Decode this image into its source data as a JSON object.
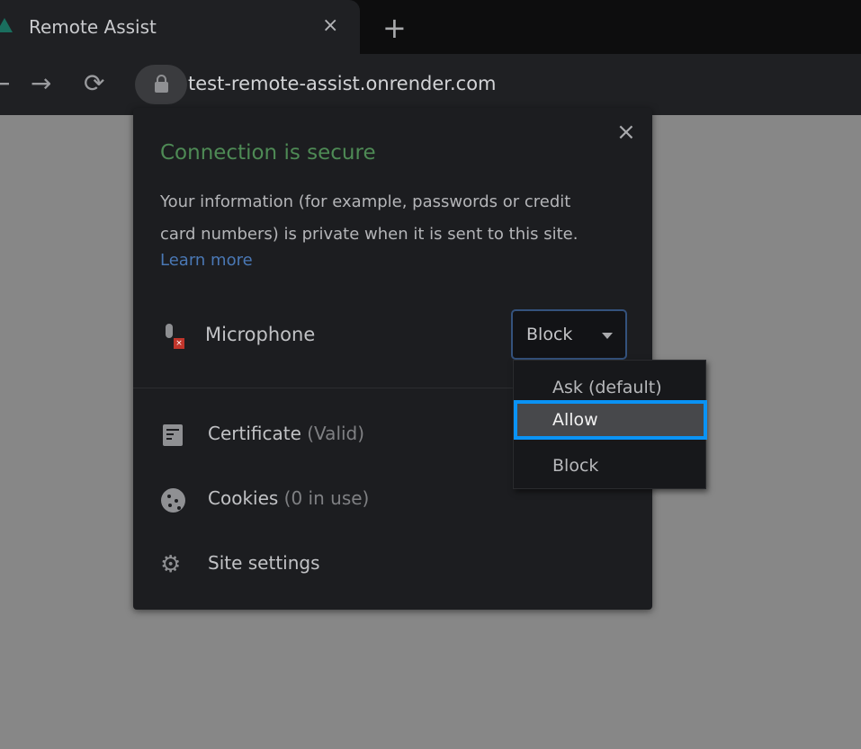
{
  "browser": {
    "tab": {
      "title": "Remote Assist",
      "favicon": "app-triangle-icon",
      "close": "×"
    },
    "new_tab": "+",
    "nav": {
      "back": "←",
      "forward": "→",
      "reload": "⟳"
    },
    "url": "test-remote-assist.onrender.com"
  },
  "popup": {
    "close": "×",
    "title": "Connection is secure",
    "description": "Your information (for example, passwords or credit card numbers) is private when it is sent to this site.",
    "learn_more": "Learn more",
    "permission": {
      "label": "Microphone",
      "value": "Block",
      "icon": "microphone-blocked-icon"
    },
    "rows": [
      {
        "label": "Certificate",
        "sub": "(Valid)",
        "icon": "certificate-icon"
      },
      {
        "label": "Cookies",
        "sub": "(0 in use)",
        "icon": "cookie-icon"
      },
      {
        "label": "Site settings",
        "sub": "",
        "icon": "gear-icon"
      }
    ],
    "dropdown": {
      "options": [
        "Ask (default)",
        "Allow",
        "Block"
      ],
      "highlighted": "Allow"
    }
  },
  "colors": {
    "secure_green": "#4e8a55",
    "link": "#4a78b5",
    "focus_ring": "#0a93f5",
    "blocked_red": "#c0352b"
  }
}
